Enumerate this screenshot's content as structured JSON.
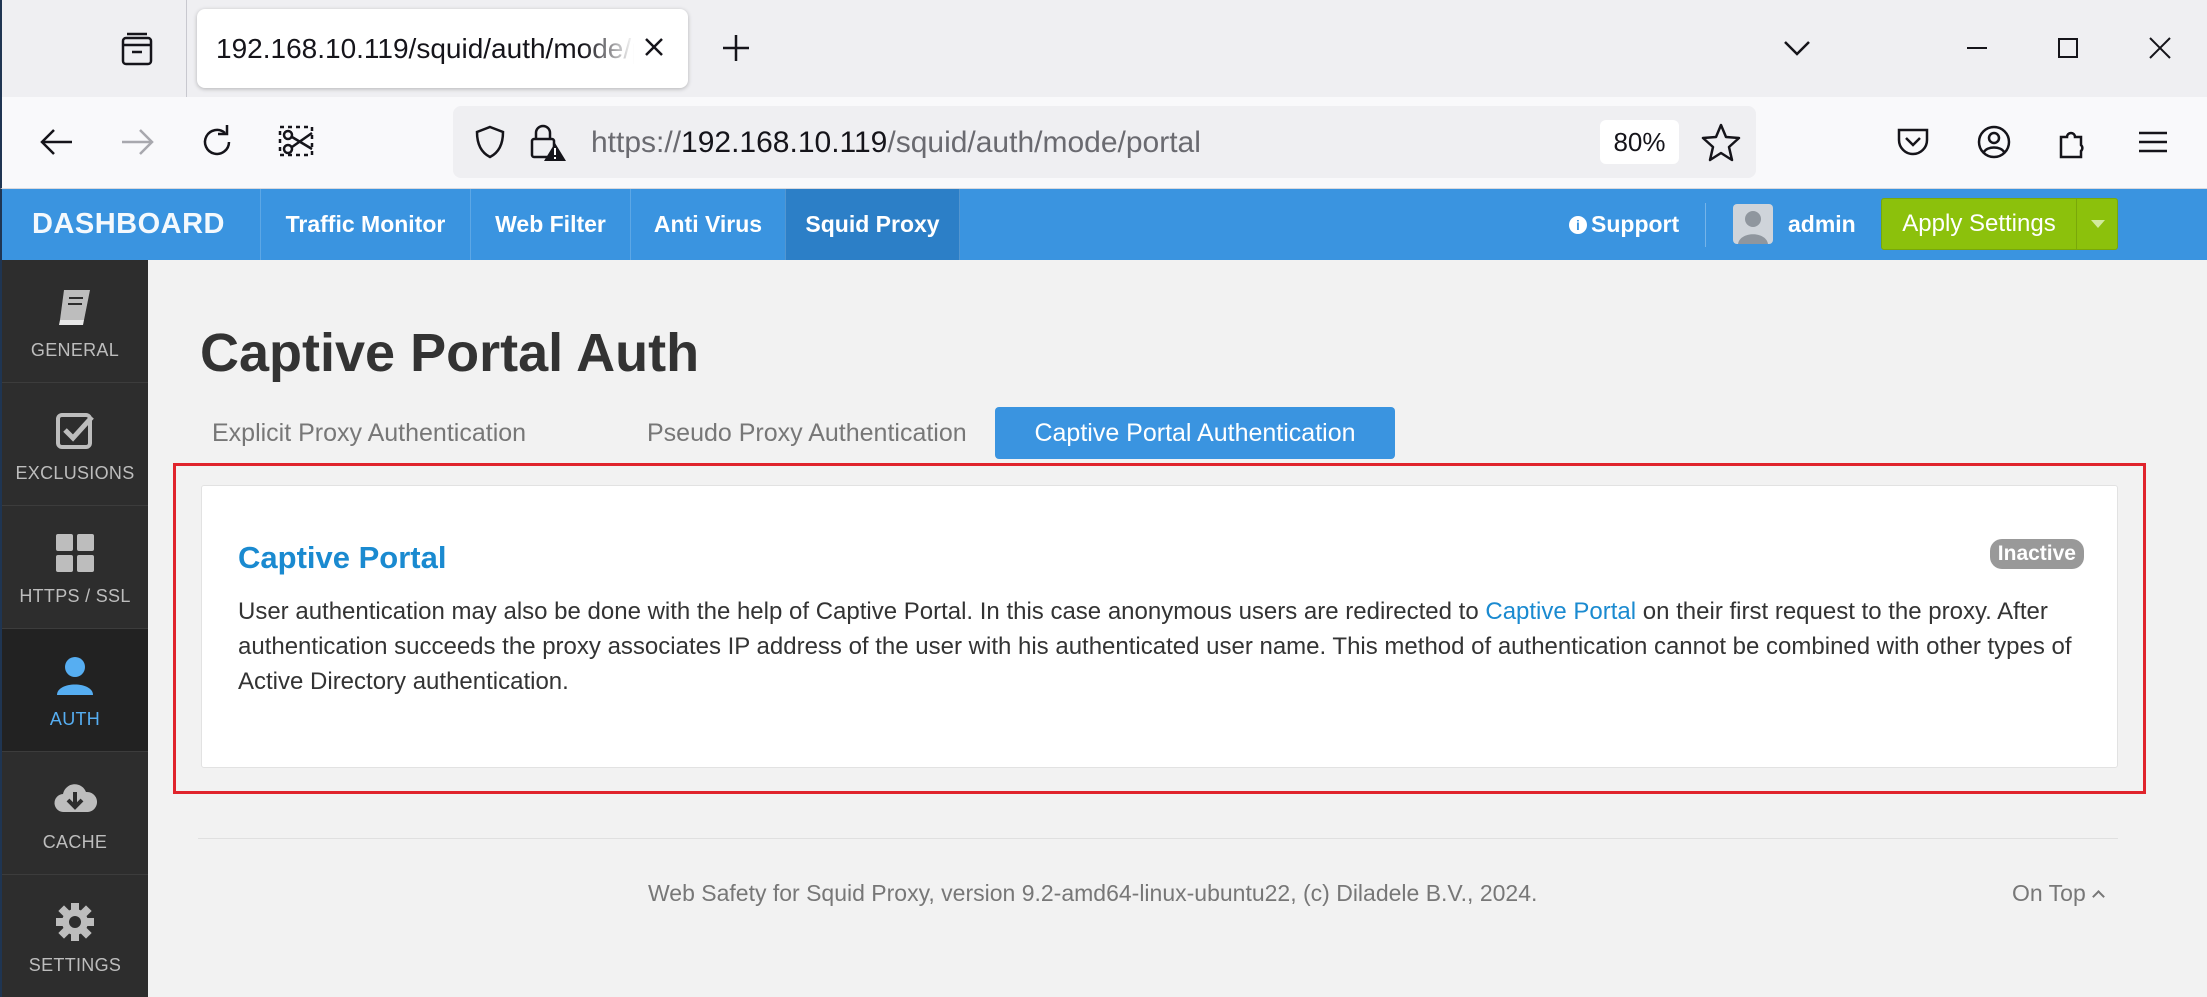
{
  "browser": {
    "tab_title": "192.168.10.119/squid/auth/mode/portal",
    "url_scheme": "https://",
    "url_host": "192.168.10.119",
    "url_path": "/squid/auth/mode/portal",
    "zoom": "80%"
  },
  "appnav": {
    "brand": "DASHBOARD",
    "items": [
      {
        "label": "Traffic Monitor"
      },
      {
        "label": "Web Filter"
      },
      {
        "label": "Anti Virus"
      },
      {
        "label": "Squid Proxy"
      }
    ],
    "support": "Support",
    "user": "admin",
    "apply": "Apply Settings"
  },
  "sidebar": {
    "items": [
      {
        "label": "GENERAL",
        "icon": "book-icon"
      },
      {
        "label": "EXCLUSIONS",
        "icon": "checkbox-icon"
      },
      {
        "label": "HTTPS / SSL",
        "icon": "grid-icon"
      },
      {
        "label": "AUTH",
        "icon": "user-icon"
      },
      {
        "label": "CACHE",
        "icon": "cloud-download-icon"
      },
      {
        "label": "SETTINGS",
        "icon": "gear-icon"
      }
    ]
  },
  "page": {
    "title": "Captive Portal Auth",
    "tabs": [
      {
        "label": "Explicit Proxy Authentication"
      },
      {
        "label": "Pseudo Proxy Authentication"
      },
      {
        "label": "Captive Portal Authentication"
      }
    ],
    "panel": {
      "title": "Captive Portal",
      "status": "Inactive",
      "desc_part1": "User authentication may also be done with the help of Captive Portal. In this case anonymous users are redirected to ",
      "desc_link": "Captive Portal",
      "desc_part2": " on their first request to the proxy. After authentication succeeds the proxy associates IP address of the user with his authenticated user name. This method of authentication cannot be combined with other types of Active Directory authentication."
    },
    "footer": "Web Safety for Squid Proxy, version 9.2-amd64-linux-ubuntu22, (c) Diladele B.V., 2024.",
    "on_top": "On Top"
  },
  "colors": {
    "nav_blue": "#3a94e0",
    "apply_green": "#8cc10c",
    "link_blue": "#1a8ad0",
    "highlight_red": "#e0242c"
  }
}
